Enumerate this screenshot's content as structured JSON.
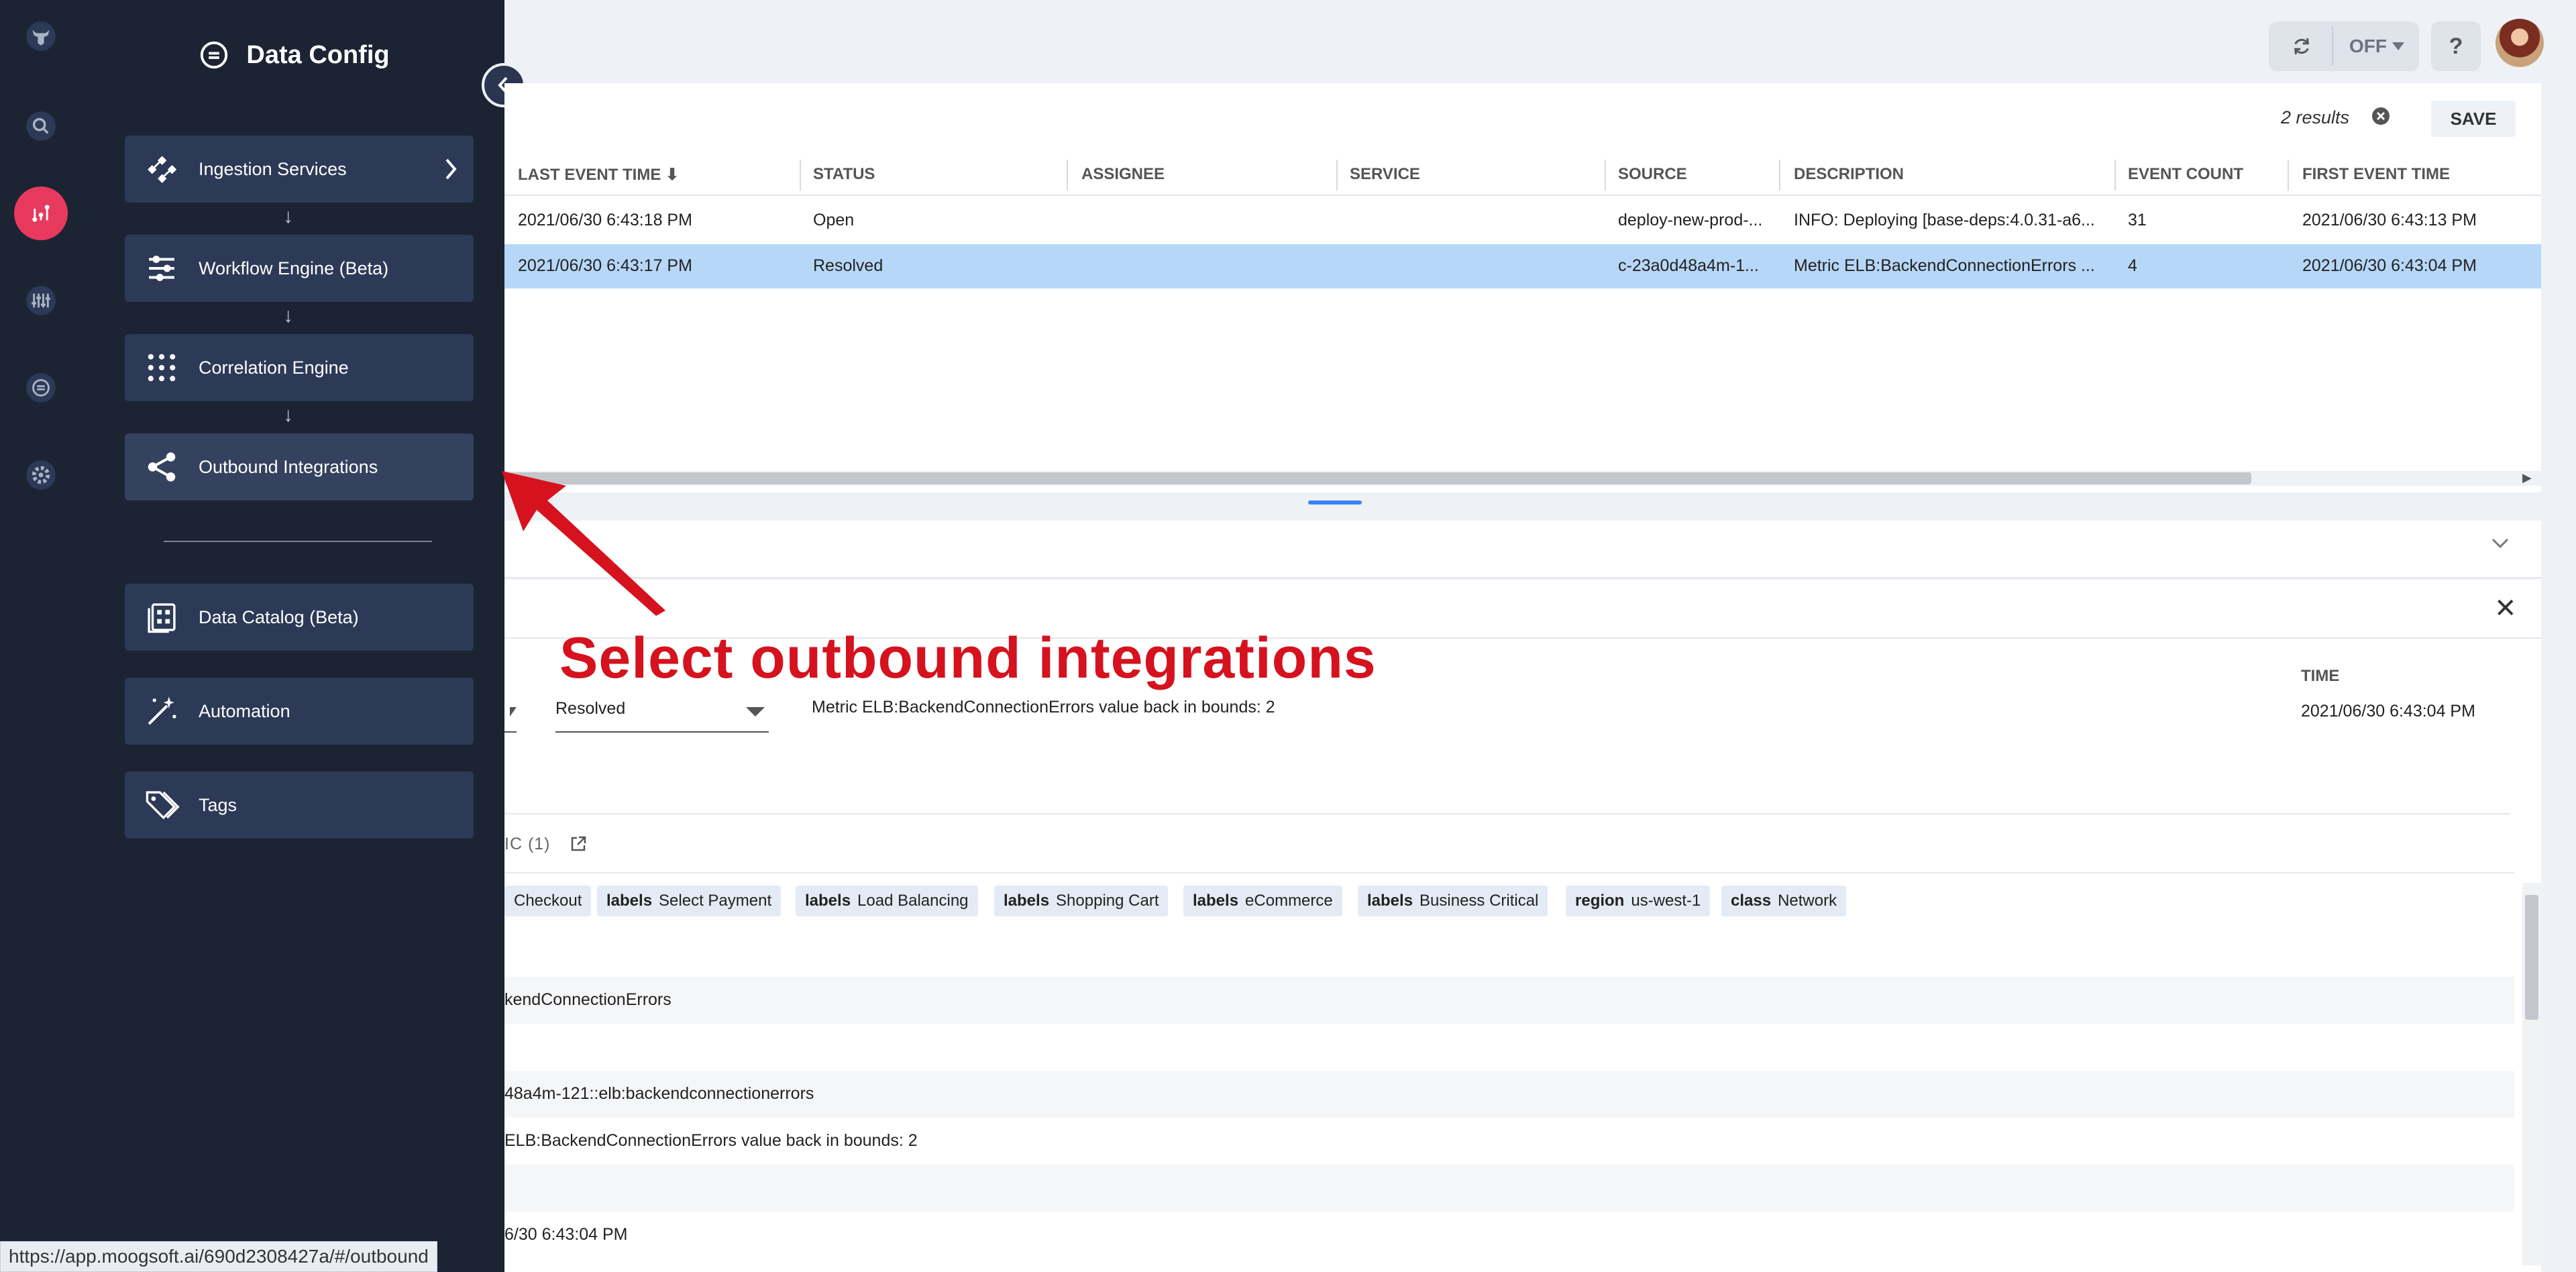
{
  "panel": {
    "title": "Data Config",
    "menu": [
      {
        "label": "Ingestion Services",
        "icon": "ingestion-icon",
        "has_chevron": true
      },
      {
        "label": "Workflow Engine (Beta)",
        "icon": "workflow-icon"
      },
      {
        "label": "Correlation Engine",
        "icon": "correlation-icon"
      },
      {
        "label": "Outbound Integrations",
        "icon": "share-icon"
      },
      {
        "label": "Data Catalog (Beta)",
        "icon": "catalog-icon"
      },
      {
        "label": "Automation",
        "icon": "magic-wand-icon"
      },
      {
        "label": "Tags",
        "icon": "tags-icon"
      }
    ],
    "flow_arrow": "↓"
  },
  "rail": {
    "items": [
      "logo-icon",
      "search-icon",
      "analytics-icon",
      "tuning-icon",
      "data-config-icon",
      "settings-icon"
    ],
    "active_color": "#e8395f"
  },
  "topbar": {
    "toggle_label": "OFF",
    "help_label": "?"
  },
  "results": {
    "count_label": "2 results",
    "save_label": "SAVE",
    "columns": [
      "LAST EVENT TIME ⬇",
      "STATUS",
      "ASSIGNEE",
      "SERVICE",
      "SOURCE",
      "DESCRIPTION",
      "EVENT COUNT",
      "FIRST EVENT TIME"
    ],
    "rows": [
      {
        "last_event_time": "2021/06/30 6:43:18 PM",
        "status": "Open",
        "assignee": "",
        "service": "",
        "source": "deploy-new-prod-...",
        "description": "INFO: Deploying [base-deps:4.0.31-a6...",
        "event_count": "31",
        "first_event_time": "2021/06/30 6:43:13 PM",
        "selected": false
      },
      {
        "last_event_time": "2021/06/30 6:43:17 PM",
        "status": "Resolved",
        "assignee": "",
        "service": "",
        "source": "c-23a0d48a4m-1...",
        "description": "Metric ELB:BackendConnectionErrors ...",
        "event_count": "4",
        "first_event_time": "2021/06/30 6:43:04 PM",
        "selected": true
      }
    ]
  },
  "detail": {
    "time_label": "TIME",
    "time_value": "2021/06/30 6:43:04 PM",
    "status_value": "Resolved",
    "description": "Metric ELB:BackendConnectionErrors value back in bounds: 2",
    "tab_partial": "IC (1)",
    "tags": [
      {
        "key": "",
        "value": "Checkout"
      },
      {
        "key": "labels",
        "value": "Select Payment"
      },
      {
        "key": "labels",
        "value": "Load Balancing"
      },
      {
        "key": "labels",
        "value": "Shopping Cart"
      },
      {
        "key": "labels",
        "value": "eCommerce"
      },
      {
        "key": "labels",
        "value": "Business Critical"
      },
      {
        "key": "region",
        "value": "us-west-1"
      },
      {
        "key": "class",
        "value": "Network"
      }
    ],
    "lines": [
      "kendConnectionErrors",
      "48a4m-121::elb:backendconnectionerrors",
      "ELB:BackendConnectionErrors value back in bounds: 2",
      "6/30 6:43:04 PM"
    ]
  },
  "annotation": {
    "text": "Select outbound integrations",
    "color": "#d5121e"
  },
  "status_url": "https://app.moogsoft.ai/690d2308427a/#/outbound"
}
